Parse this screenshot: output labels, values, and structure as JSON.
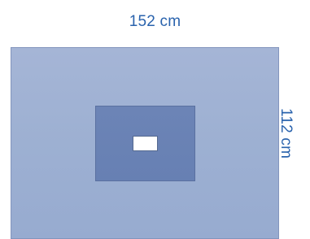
{
  "dimensions": {
    "width_label": "152 cm",
    "height_label": "112 cm"
  },
  "colors": {
    "label_text": "#2a63ad",
    "drape_fill": "#9fb2d3",
    "reinforcement_fill": "#6a82b5",
    "fenestration_fill": "#ffffff"
  }
}
